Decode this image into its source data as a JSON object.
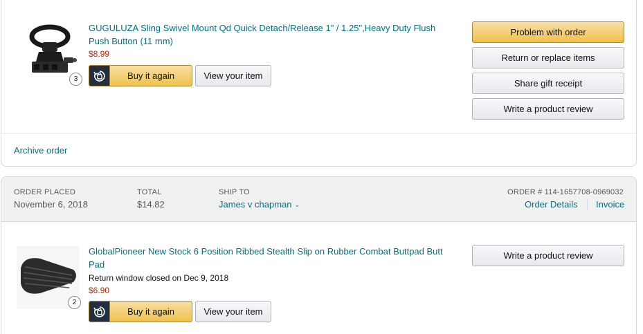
{
  "orders": [
    {
      "item": {
        "title": "GUGULUZA Sling Swivel Mount Qd Quick Detach/Release 1\" / 1.25\",Heavy Duty Flush Push Button (11 mm)",
        "price": "$8.99",
        "quantity": "3",
        "image_icon": "sling-swivel-mount-image"
      },
      "buy_again_label": "Buy it again",
      "view_item_label": "View your item",
      "actions": [
        {
          "label": "Problem with order",
          "style": "primary"
        },
        {
          "label": "Return or replace items",
          "style": "secondary"
        },
        {
          "label": "Share gift receipt",
          "style": "secondary"
        },
        {
          "label": "Write a product review",
          "style": "secondary"
        }
      ],
      "archive_label": "Archive order"
    },
    {
      "header": {
        "order_placed_label": "ORDER PLACED",
        "order_placed_value": "November 6, 2018",
        "total_label": "TOTAL",
        "total_value": "$14.82",
        "ship_to_label": "SHIP TO",
        "ship_to_value": "James v chapman",
        "order_number_label": "ORDER # 114-1657708-0969032",
        "order_details_label": "Order Details",
        "invoice_label": "Invoice"
      },
      "item": {
        "title": "GlobalPioneer New Stock 6 Position Ribbed Stealth Slip on Rubber Combat Buttpad Butt Pad",
        "note": "Return window closed on Dec 9, 2018",
        "price": "$6.90",
        "quantity": "2",
        "image_icon": "rubber-buttpad-image"
      },
      "buy_again_label": "Buy it again",
      "view_item_label": "View your item",
      "actions": [
        {
          "label": "Write a product review",
          "style": "secondary"
        }
      ]
    }
  ],
  "colors": {
    "link": "#007185",
    "price": "#b12704",
    "button_primary": "#f0c14b",
    "header_bg": "#f0f2f2",
    "icon_bg": "#232f3e"
  }
}
